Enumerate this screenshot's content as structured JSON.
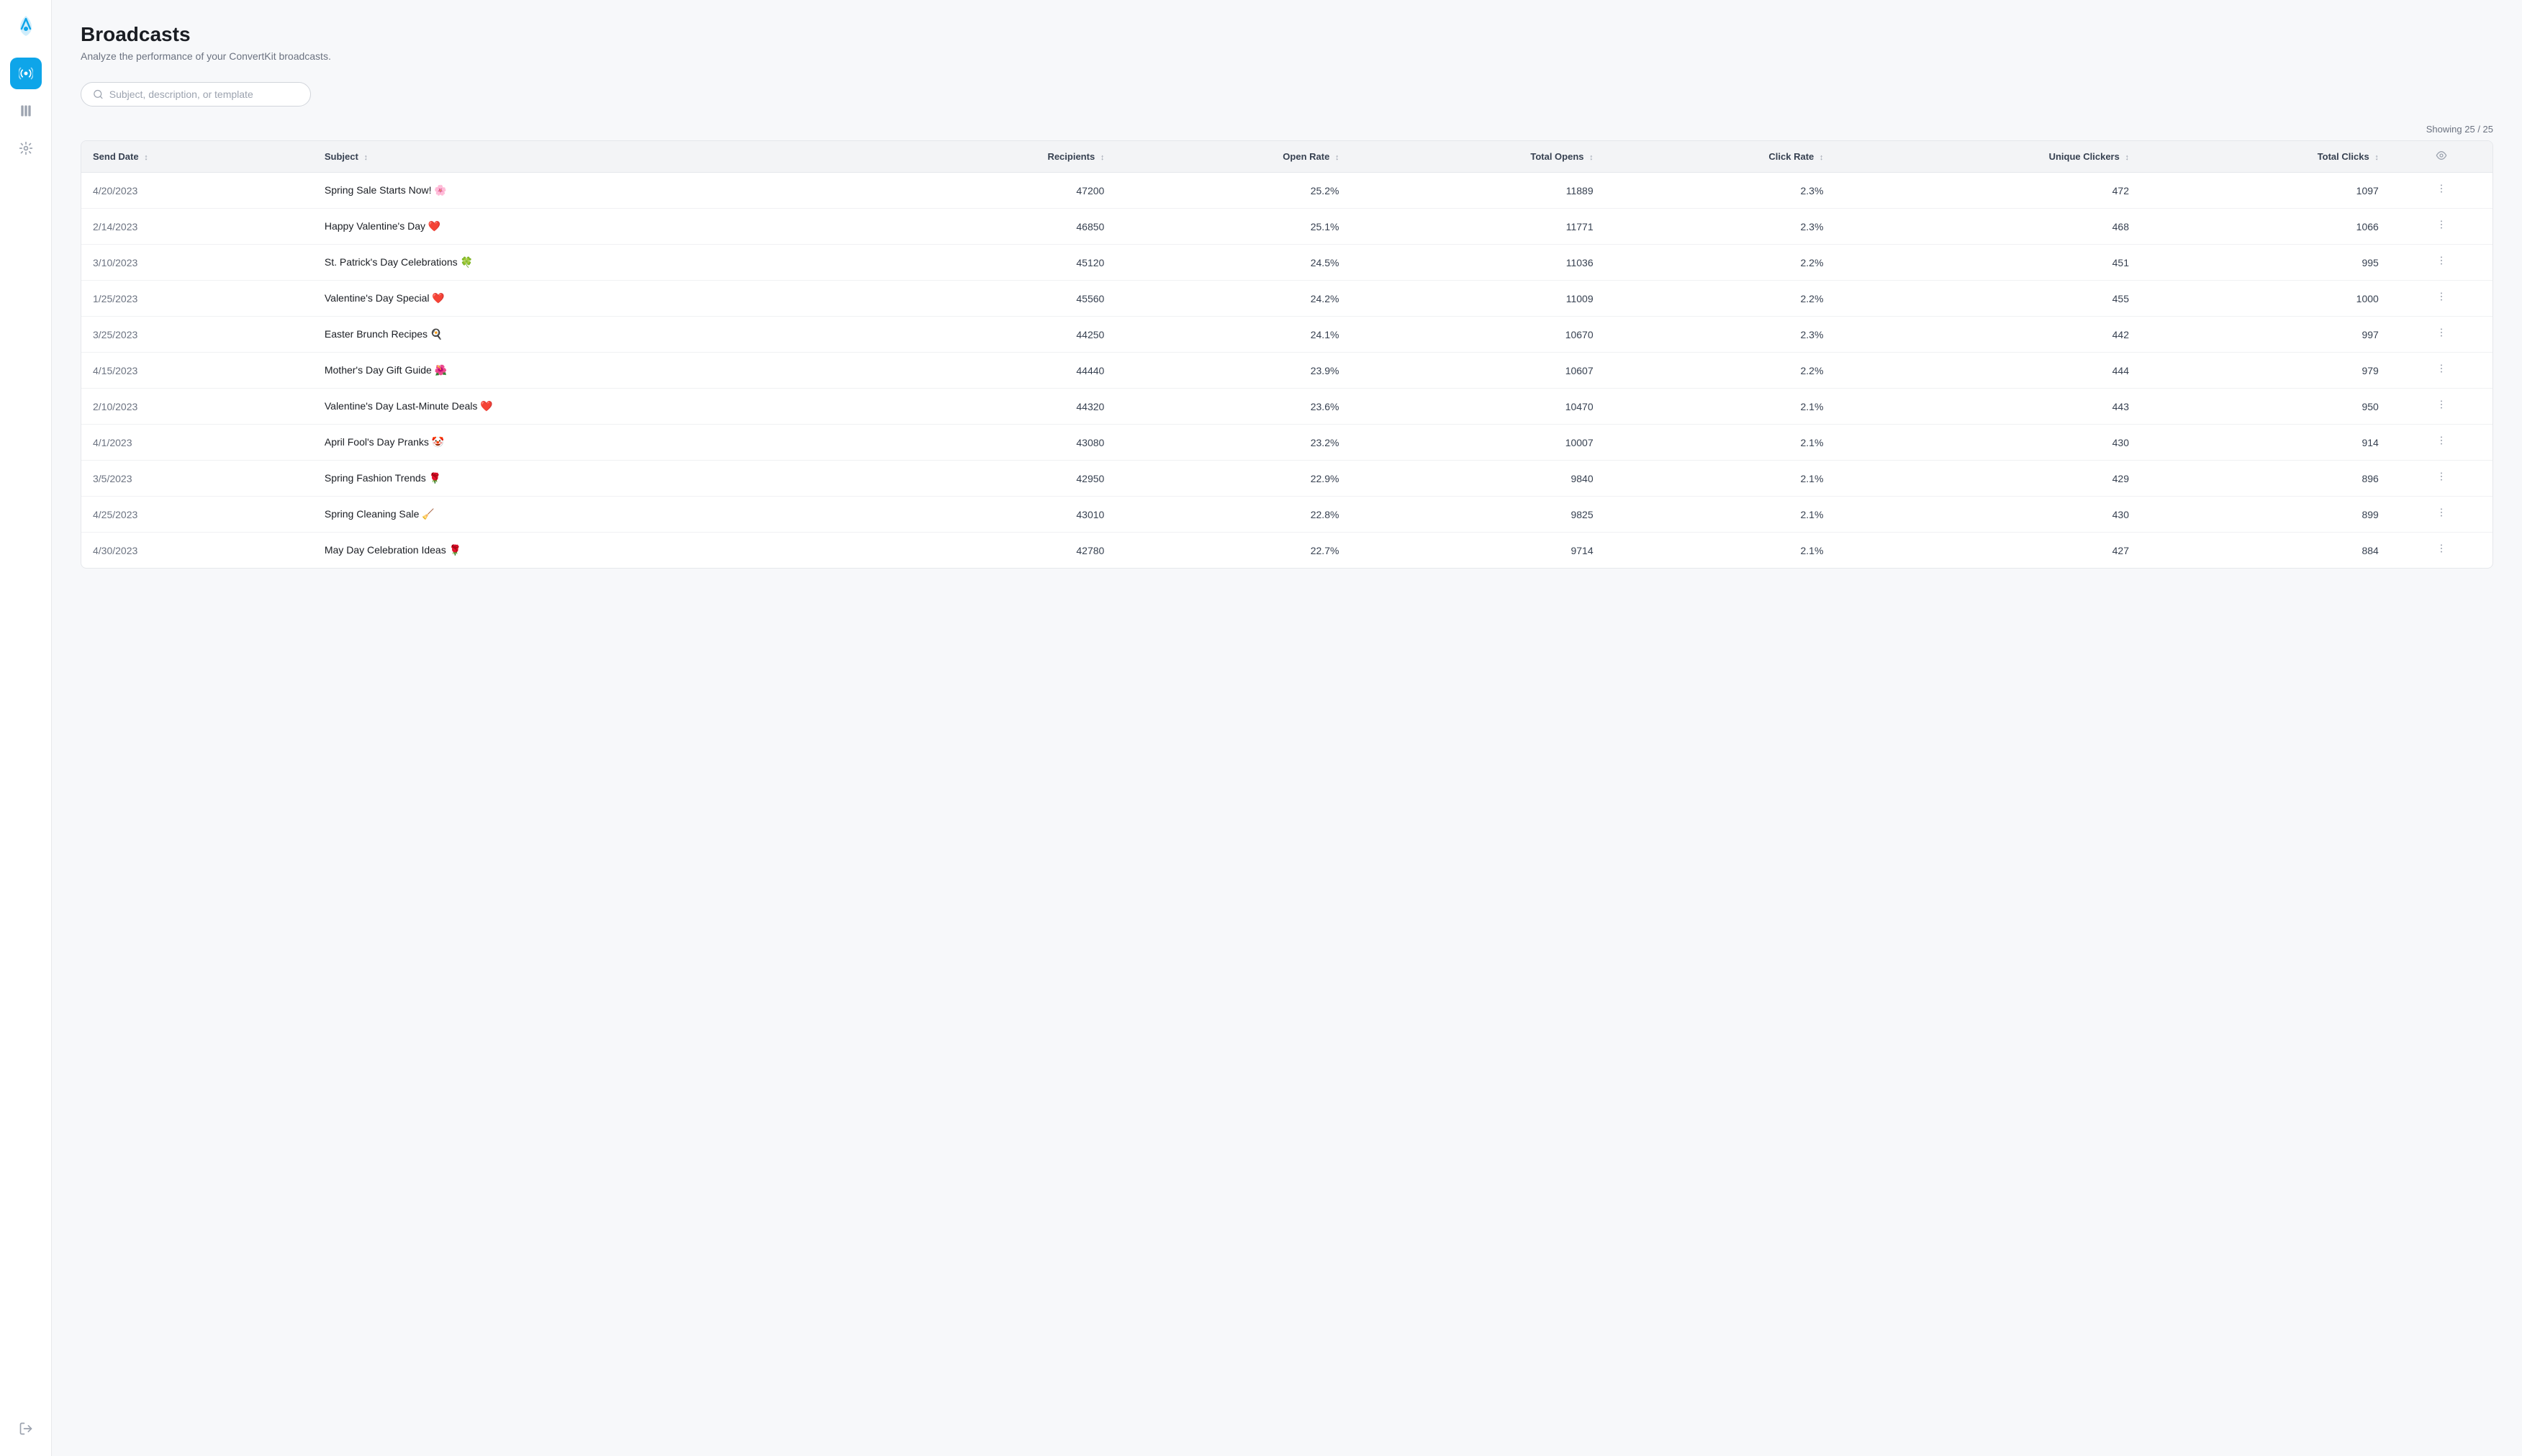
{
  "app": {
    "logo_icon": "🚀"
  },
  "sidebar": {
    "items": [
      {
        "id": "broadcasts",
        "icon": "📡",
        "active": true
      },
      {
        "id": "library",
        "icon": "📚",
        "active": false
      },
      {
        "id": "settings",
        "icon": "⚙️",
        "active": false
      }
    ],
    "bottom_items": [
      {
        "id": "logout",
        "icon": "↪"
      }
    ]
  },
  "page": {
    "title": "Broadcasts",
    "subtitle": "Analyze the performance of your ConvertKit broadcasts.",
    "showing": "Showing 25 / 25"
  },
  "search": {
    "placeholder": "Subject, description, or template"
  },
  "table": {
    "columns": [
      {
        "id": "send_date",
        "label": "Send Date",
        "sortable": true
      },
      {
        "id": "subject",
        "label": "Subject",
        "sortable": true
      },
      {
        "id": "recipients",
        "label": "Recipients",
        "sortable": true,
        "align": "right"
      },
      {
        "id": "open_rate",
        "label": "Open Rate",
        "sortable": true,
        "align": "right"
      },
      {
        "id": "total_opens",
        "label": "Total Opens",
        "sortable": true,
        "align": "right"
      },
      {
        "id": "click_rate",
        "label": "Click Rate",
        "sortable": true,
        "align": "right"
      },
      {
        "id": "unique_clickers",
        "label": "Unique Clickers",
        "sortable": true,
        "align": "right"
      },
      {
        "id": "total_clicks",
        "label": "Total Clicks",
        "sortable": true,
        "align": "right"
      },
      {
        "id": "actions",
        "label": "",
        "sortable": false,
        "align": "center"
      }
    ],
    "rows": [
      {
        "send_date": "4/20/2023",
        "subject": "Spring Sale Starts Now! 🌸",
        "recipients": "47200",
        "open_rate": "25.2%",
        "total_opens": "11889",
        "click_rate": "2.3%",
        "unique_clickers": "472",
        "total_clicks": "1097"
      },
      {
        "send_date": "2/14/2023",
        "subject": "Happy Valentine's Day ❤️",
        "recipients": "46850",
        "open_rate": "25.1%",
        "total_opens": "11771",
        "click_rate": "2.3%",
        "unique_clickers": "468",
        "total_clicks": "1066"
      },
      {
        "send_date": "3/10/2023",
        "subject": "St. Patrick's Day Celebrations 🍀",
        "recipients": "45120",
        "open_rate": "24.5%",
        "total_opens": "11036",
        "click_rate": "2.2%",
        "unique_clickers": "451",
        "total_clicks": "995"
      },
      {
        "send_date": "1/25/2023",
        "subject": "Valentine's Day Special ❤️",
        "recipients": "45560",
        "open_rate": "24.2%",
        "total_opens": "11009",
        "click_rate": "2.2%",
        "unique_clickers": "455",
        "total_clicks": "1000"
      },
      {
        "send_date": "3/25/2023",
        "subject": "Easter Brunch Recipes 🍳",
        "recipients": "44250",
        "open_rate": "24.1%",
        "total_opens": "10670",
        "click_rate": "2.3%",
        "unique_clickers": "442",
        "total_clicks": "997"
      },
      {
        "send_date": "4/15/2023",
        "subject": "Mother's Day Gift Guide 🌺",
        "recipients": "44440",
        "open_rate": "23.9%",
        "total_opens": "10607",
        "click_rate": "2.2%",
        "unique_clickers": "444",
        "total_clicks": "979"
      },
      {
        "send_date": "2/10/2023",
        "subject": "Valentine's Day Last-Minute Deals ❤️",
        "recipients": "44320",
        "open_rate": "23.6%",
        "total_opens": "10470",
        "click_rate": "2.1%",
        "unique_clickers": "443",
        "total_clicks": "950"
      },
      {
        "send_date": "4/1/2023",
        "subject": "April Fool's Day Pranks 🤡",
        "recipients": "43080",
        "open_rate": "23.2%",
        "total_opens": "10007",
        "click_rate": "2.1%",
        "unique_clickers": "430",
        "total_clicks": "914"
      },
      {
        "send_date": "3/5/2023",
        "subject": "Spring Fashion Trends 🌹",
        "recipients": "42950",
        "open_rate": "22.9%",
        "total_opens": "9840",
        "click_rate": "2.1%",
        "unique_clickers": "429",
        "total_clicks": "896"
      },
      {
        "send_date": "4/25/2023",
        "subject": "Spring Cleaning Sale 🧹",
        "recipients": "43010",
        "open_rate": "22.8%",
        "total_opens": "9825",
        "click_rate": "2.1%",
        "unique_clickers": "430",
        "total_clicks": "899"
      },
      {
        "send_date": "4/30/2023",
        "subject": "May Day Celebration Ideas 🌹",
        "recipients": "42780",
        "open_rate": "22.7%",
        "total_opens": "9714",
        "click_rate": "2.1%",
        "unique_clickers": "427",
        "total_clicks": "884"
      }
    ]
  }
}
